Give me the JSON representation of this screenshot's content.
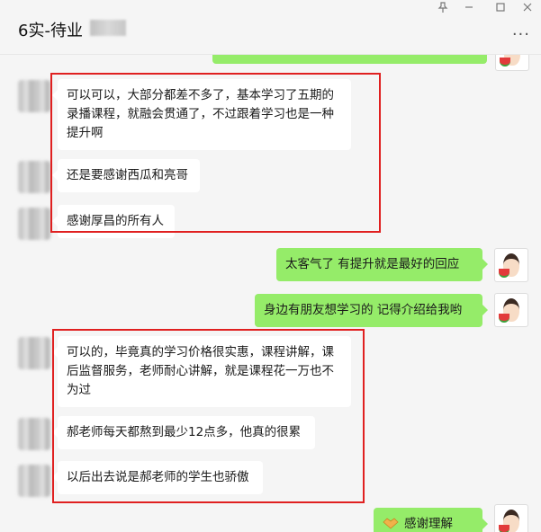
{
  "window": {
    "title": "6实-待业",
    "pin_icon": "pin-icon",
    "minimize_icon": "minimize-icon",
    "maximize_icon": "maximize-icon",
    "close_icon": "close-icon",
    "more_icon": "more-icon"
  },
  "messages": [
    {
      "side": "left",
      "text": "可以可以，大部分都差不多了，基本学习了五期的录播课程，就融会贯通了，不过跟着学习也是一种提升啊"
    },
    {
      "side": "left",
      "text": "还是要感谢西瓜和亮哥"
    },
    {
      "side": "left",
      "text": "感谢厚昌的所有人"
    },
    {
      "side": "right",
      "text": "太客气了  有提升就是最好的回应"
    },
    {
      "side": "right",
      "text": "身边有朋友想学习的  记得介绍给我哟"
    },
    {
      "side": "left",
      "text": "可以的，毕竟真的学习价格很实惠，课程讲解，课后监督服务，老师耐心讲解，就是课程花一万也不为过"
    },
    {
      "side": "left",
      "text": "郝老师每天都熬到最少12点多，他真的很累"
    },
    {
      "side": "left",
      "text": "以后出去说是郝老师的学生也骄傲"
    },
    {
      "side": "right",
      "text": "感谢理解",
      "icon": "handshake-icon"
    }
  ],
  "colors": {
    "sent_bubble": "#95ec69",
    "received_bubble": "#ffffff",
    "chat_background": "#f5f5f5",
    "highlight_box": "#e02020"
  }
}
